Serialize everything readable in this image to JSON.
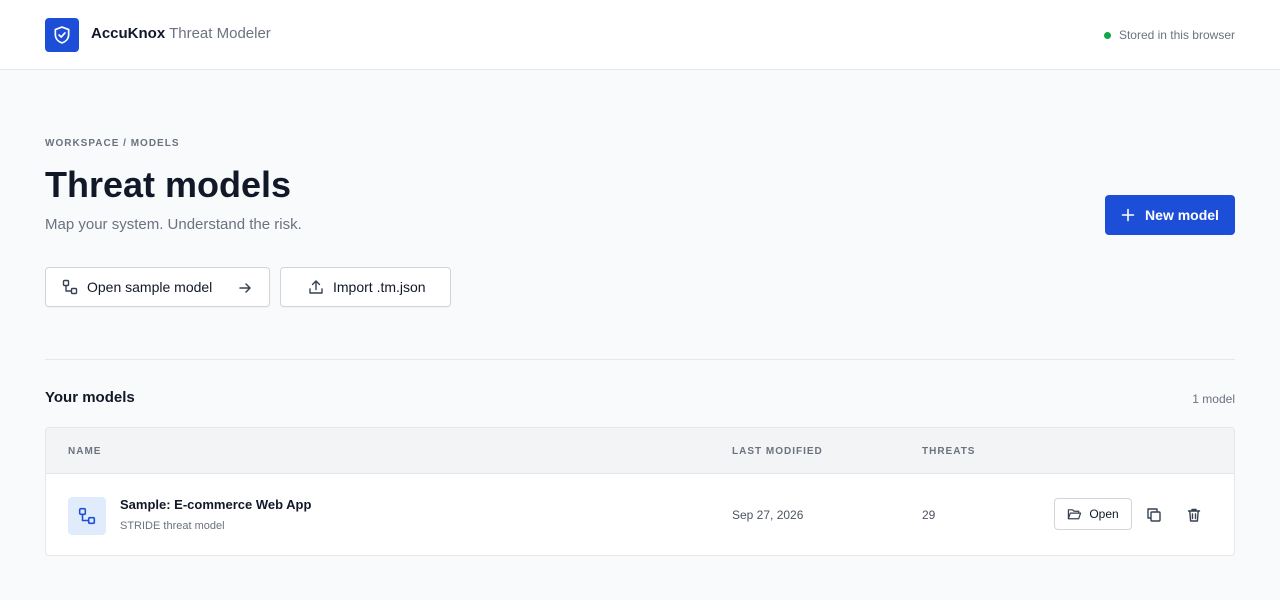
{
  "header": {
    "brand_name": "AccuKnox",
    "brand_product": "Threat Modeler",
    "logo_icon": "shield-check-icon",
    "storage_status": "Stored in this browser",
    "status_color": "#16a34a"
  },
  "hero": {
    "breadcrumb": "WORKSPACE / MODELS",
    "title": "Threat models",
    "subtitle": "Map your system. Understand the risk.",
    "new_model_label": "New model",
    "accent_color": "#1d4ed8"
  },
  "actions": {
    "open_sample_label": "Open sample model",
    "import_label": "Import .tm.json"
  },
  "models": {
    "section_title": "Your models",
    "count_label": "1 model",
    "columns": {
      "name": "NAME",
      "last_modified": "LAST MODIFIED",
      "threats": "THREATS"
    },
    "rows": [
      {
        "name": "Sample: E-commerce Web App",
        "subtitle": "STRIDE threat model",
        "last_modified": "Sep 27, 2026",
        "threats": "29",
        "open_label": "Open"
      }
    ]
  }
}
